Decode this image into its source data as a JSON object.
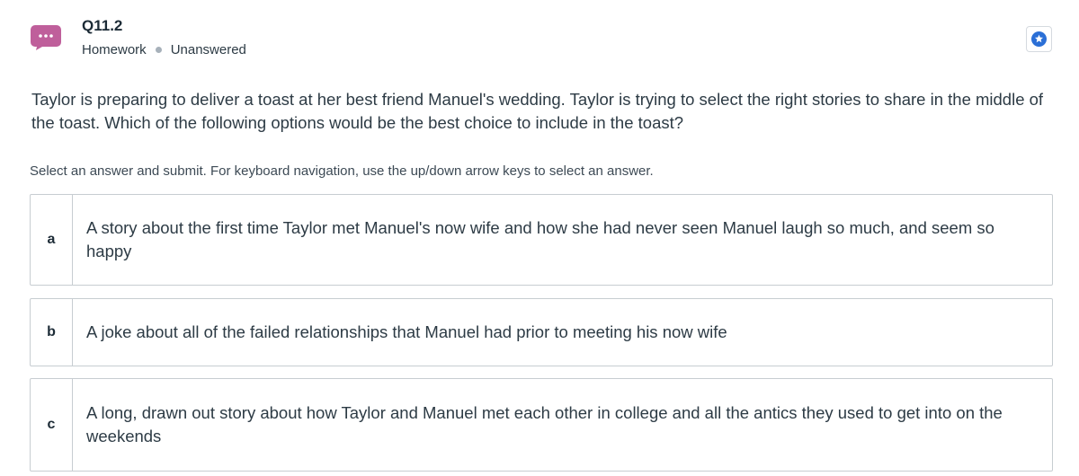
{
  "question": {
    "title": "Q11.2",
    "category": "Homework",
    "status": "Unanswered",
    "prompt": "Taylor is preparing to deliver a toast at her best friend Manuel's wedding. Taylor is trying to select the right stories to share in the middle of the toast. Which of the following options would be the best choice to include in the toast?",
    "instructions": "Select an answer and submit. For keyboard navigation, use the up/down arrow keys to select an answer."
  },
  "options": [
    {
      "letter": "a",
      "text": "A story about the first time Taylor met Manuel's now wife and how she had never seen Manuel laugh so much, and seem so happy"
    },
    {
      "letter": "b",
      "text": "A joke about all of the failed relationships that Manuel had prior to meeting his now wife"
    },
    {
      "letter": "c",
      "text": "A long, drawn out story about how Taylor and Manuel met each other in college and all the antics they used to get into on the weekends"
    }
  ],
  "icons": {
    "question_icon": "chat-bubble-ellipsis-icon",
    "bookmark_icon": "star-icon"
  },
  "colors": {
    "question_icon": "#bf5f9b",
    "star_accent": "#2b6fd6"
  }
}
